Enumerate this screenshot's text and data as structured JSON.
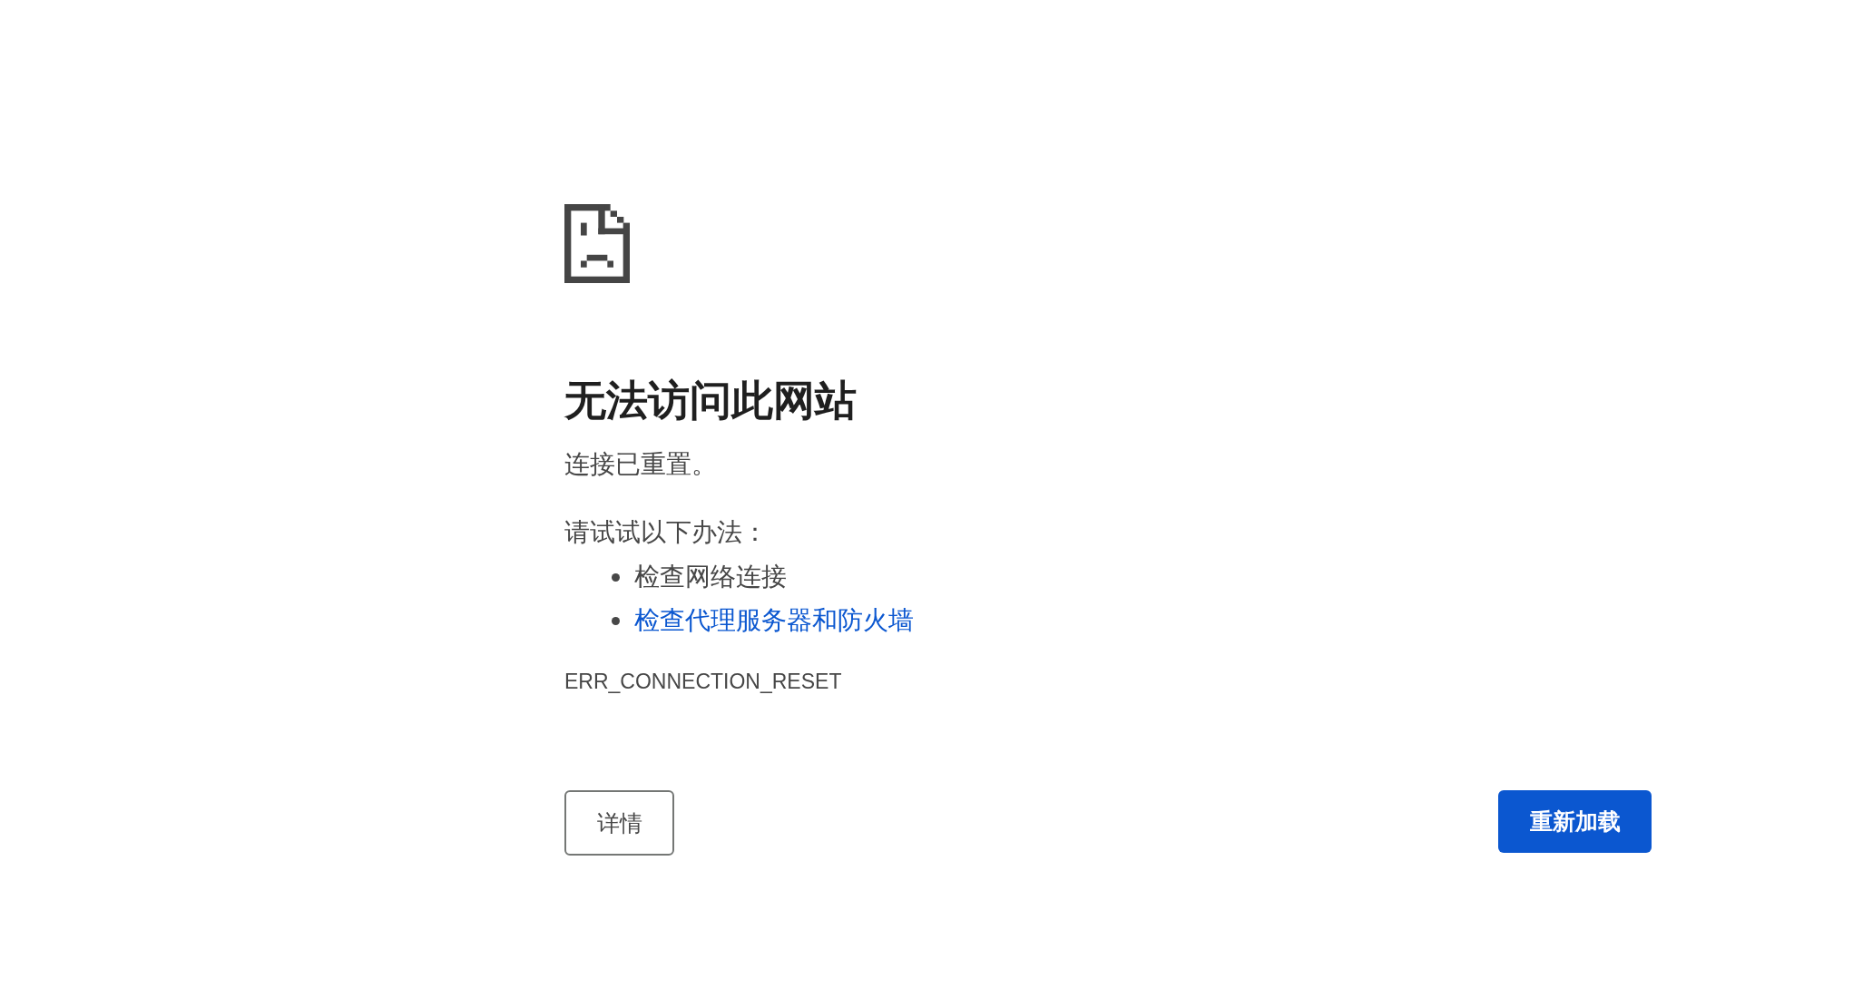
{
  "heading": "无法访问此网站",
  "message": "连接已重置。",
  "suggestions_title": "请试试以下办法：",
  "suggestions": [
    {
      "kind": "text",
      "label": "检查网络连接"
    },
    {
      "kind": "link",
      "label": "检查代理服务器和防火墙"
    }
  ],
  "error_code": "ERR_CONNECTION_RESET",
  "buttons": [
    {
      "kind": "secondary",
      "label": "详情"
    },
    {
      "kind": "primary",
      "label": "重新加载"
    }
  ]
}
